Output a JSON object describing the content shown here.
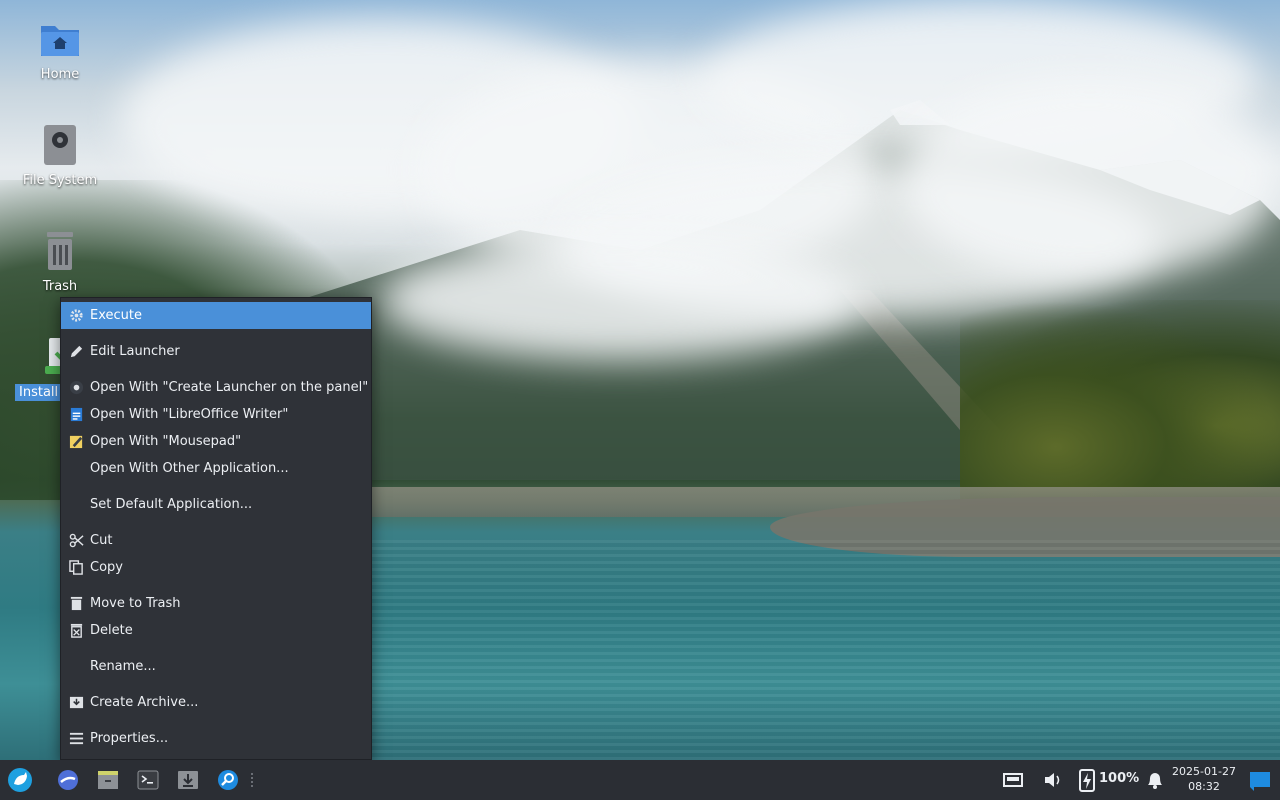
{
  "desktop": {
    "icons": [
      {
        "label": "Home",
        "icon": "home-folder-icon"
      },
      {
        "label": "File System",
        "icon": "drive-icon"
      },
      {
        "label": "Trash",
        "icon": "trash-icon"
      },
      {
        "label": "Install S",
        "icon": "installer-icon",
        "selected": true
      }
    ]
  },
  "context_menu": {
    "items": [
      {
        "label": "Execute",
        "icon": "gear-icon",
        "active": true
      },
      {
        "label": "Edit Launcher",
        "icon": "pencil-icon"
      },
      {
        "label": "Open With \"Create Launcher on the panel\"",
        "icon": "launcher-app-icon"
      },
      {
        "label": "Open With \"LibreOffice Writer\"",
        "icon": "writer-app-icon"
      },
      {
        "label": "Open With \"Mousepad\"",
        "icon": "mousepad-app-icon"
      },
      {
        "label": "Open With Other Application...",
        "icon": ""
      },
      {
        "label": "Set Default Application...",
        "icon": ""
      },
      {
        "label": "Cut",
        "icon": "scissors-icon"
      },
      {
        "label": "Copy",
        "icon": "copy-icon"
      },
      {
        "label": "Move to Trash",
        "icon": "trash-icon"
      },
      {
        "label": "Delete",
        "icon": "delete-icon"
      },
      {
        "label": "Rename...",
        "icon": ""
      },
      {
        "label": "Create Archive...",
        "icon": "archive-icon"
      },
      {
        "label": "Properties...",
        "icon": "properties-icon"
      }
    ]
  },
  "taskbar": {
    "launchers": [
      "app-menu-icon",
      "browser-icon",
      "file-manager-icon",
      "terminal-icon",
      "downloads-icon",
      "search-icon"
    ],
    "tray": {
      "network_icon": "network-icon",
      "volume_icon": "volume-icon",
      "battery_icon": "battery-charging-icon",
      "battery_level": "100%",
      "notification_icon": "bell-icon",
      "desktop_icon": "show-desktop-icon"
    },
    "clock": {
      "date": "2025-01-27",
      "time": "08:32"
    }
  },
  "colors": {
    "accent": "#4a90d9",
    "menu_bg": "#2f3238",
    "taskbar_bg": "#2b2e34"
  }
}
